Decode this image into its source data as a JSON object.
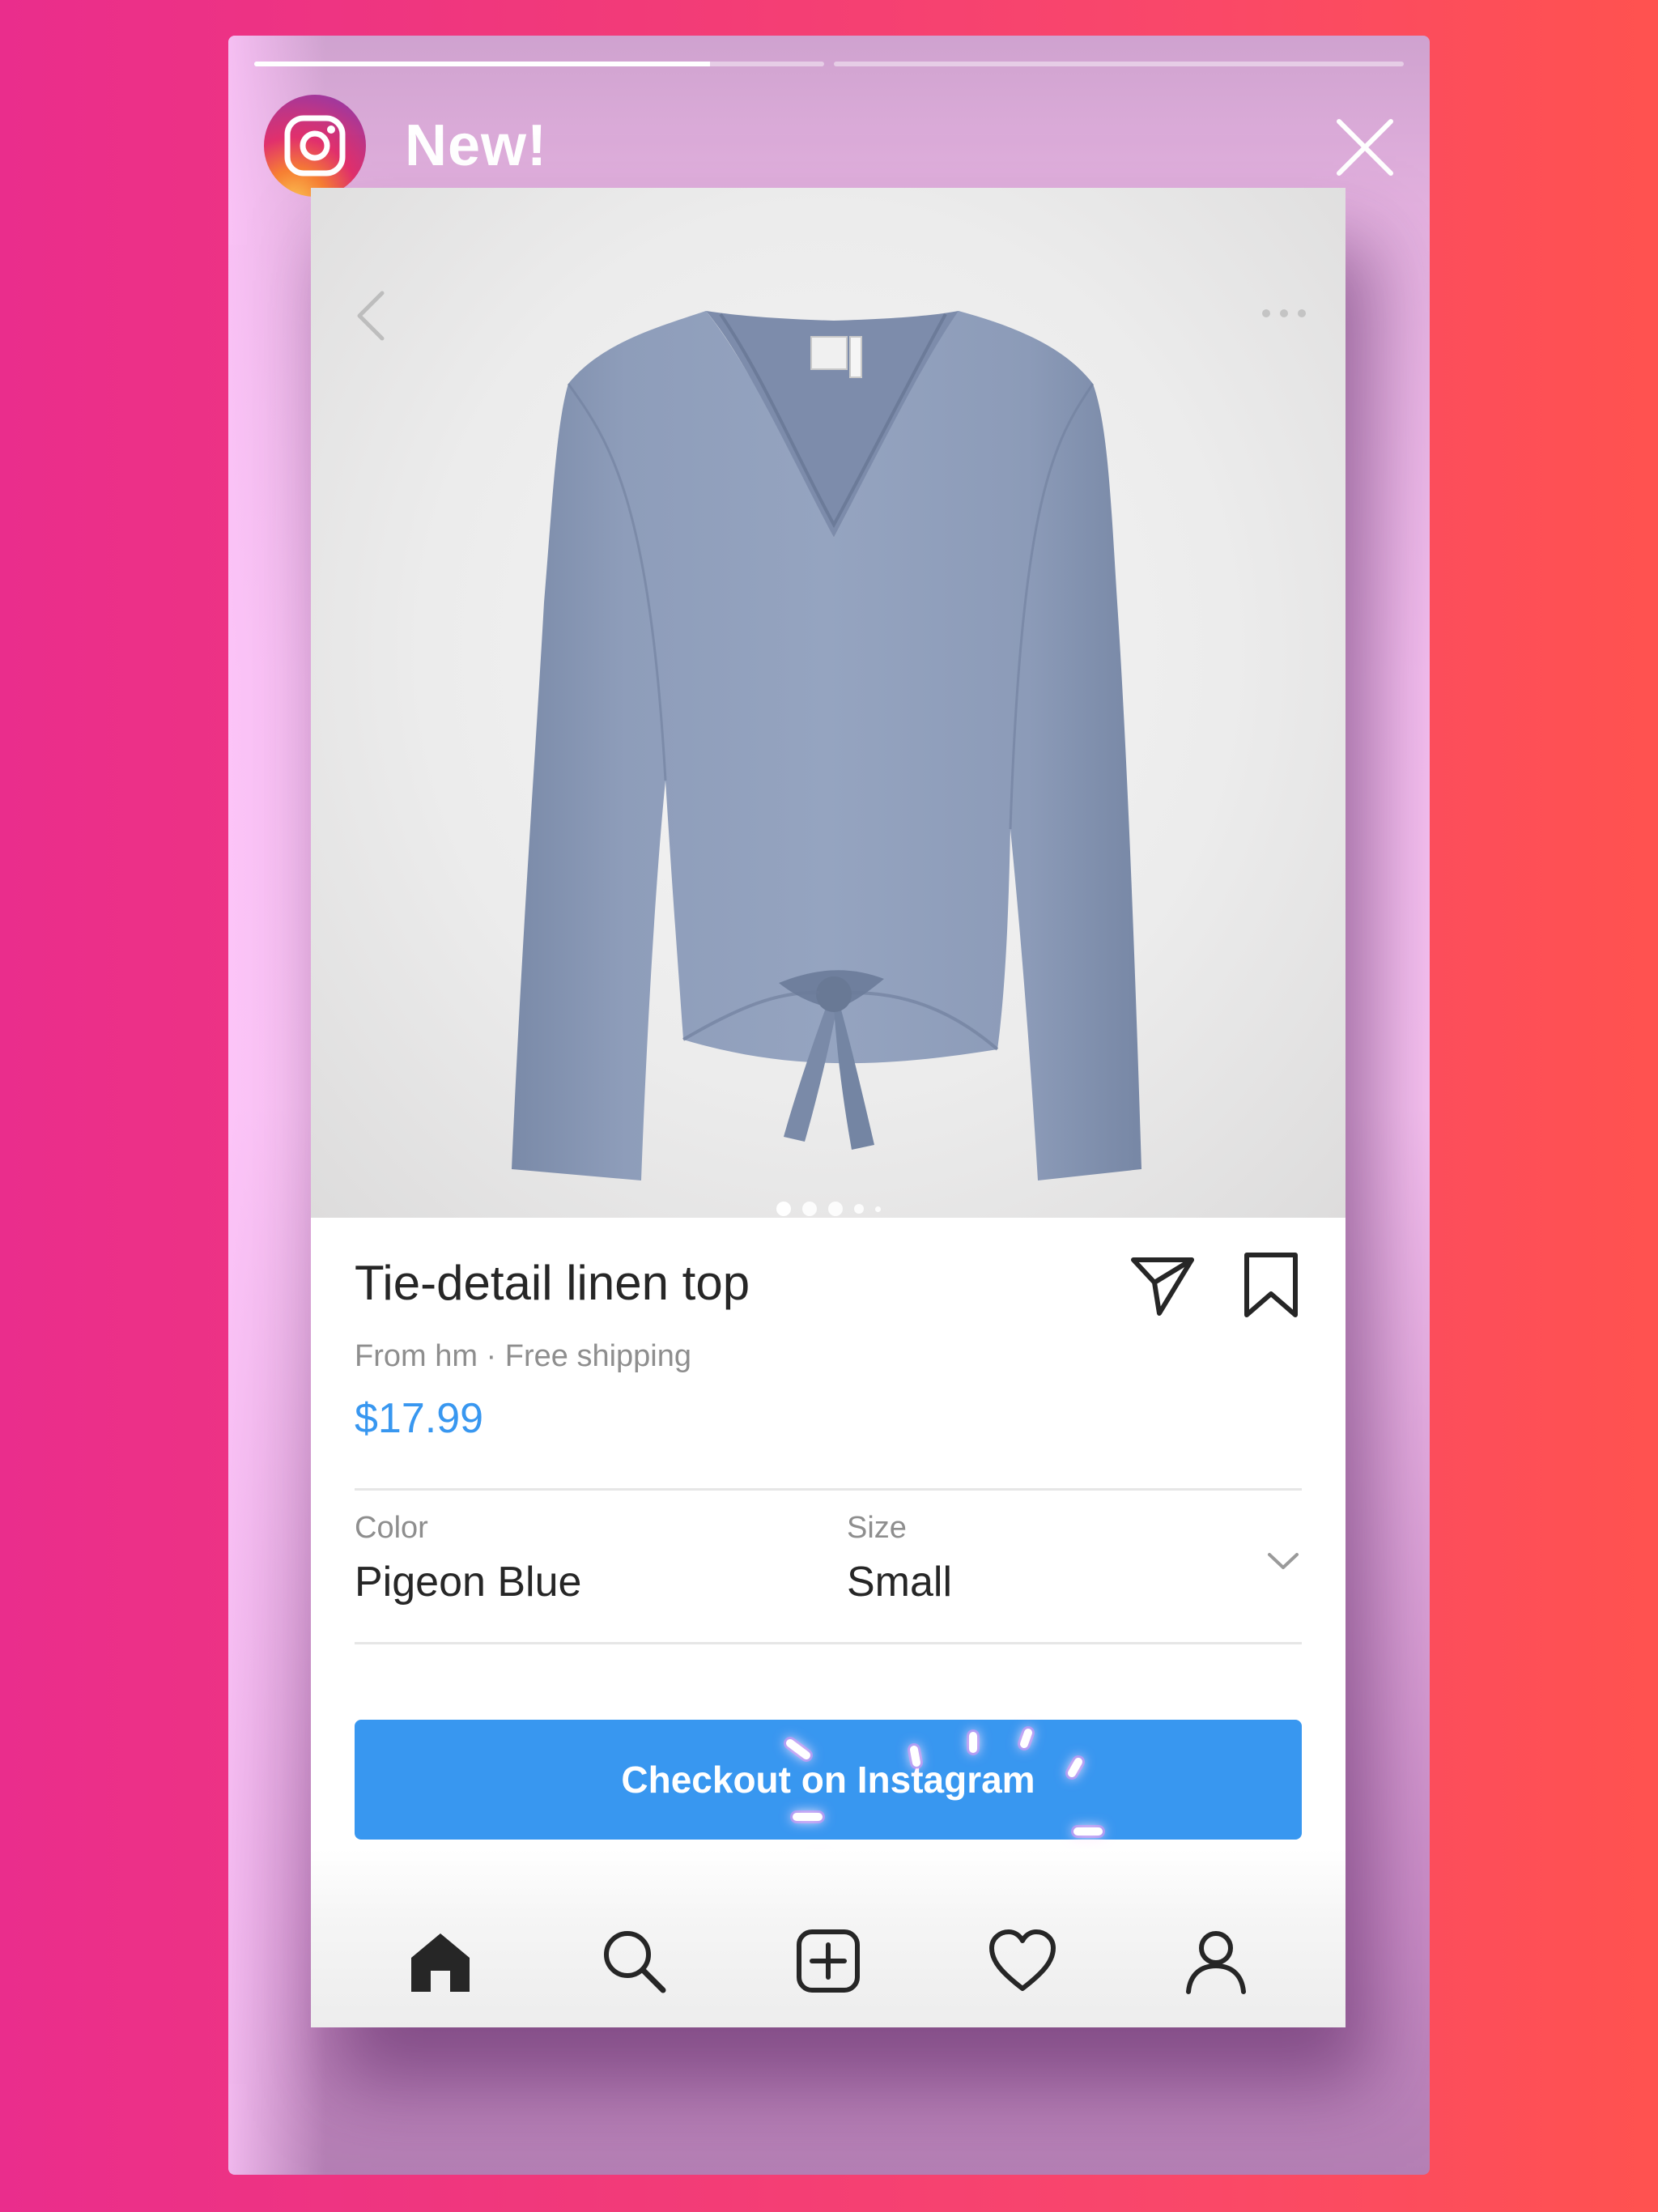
{
  "story": {
    "title": "New!",
    "progress": [
      0.8,
      0.0
    ],
    "logo_icon": "instagram-logo-icon",
    "close_icon": "close-icon"
  },
  "product": {
    "name": "Tie-detail linen top",
    "meta": "From hm · Free shipping",
    "price": "$17.99",
    "image_icon": "linen-top-garment",
    "image_page_count": 5,
    "image_active_index": 0
  },
  "options": {
    "color_label": "Color",
    "color_value": "Pigeon Blue",
    "size_label": "Size",
    "size_value": "Small"
  },
  "checkout": {
    "label": "Checkout on Instagram"
  },
  "tabbar": {
    "items": [
      "home-icon",
      "search-icon",
      "new-post-icon",
      "activity-heart-icon",
      "profile-icon"
    ],
    "active": "home-icon"
  },
  "colors": {
    "accent": "#3897f0",
    "text_primary": "#262626",
    "text_secondary": "#8e8e8e",
    "sparkle": "#ff80f4"
  }
}
